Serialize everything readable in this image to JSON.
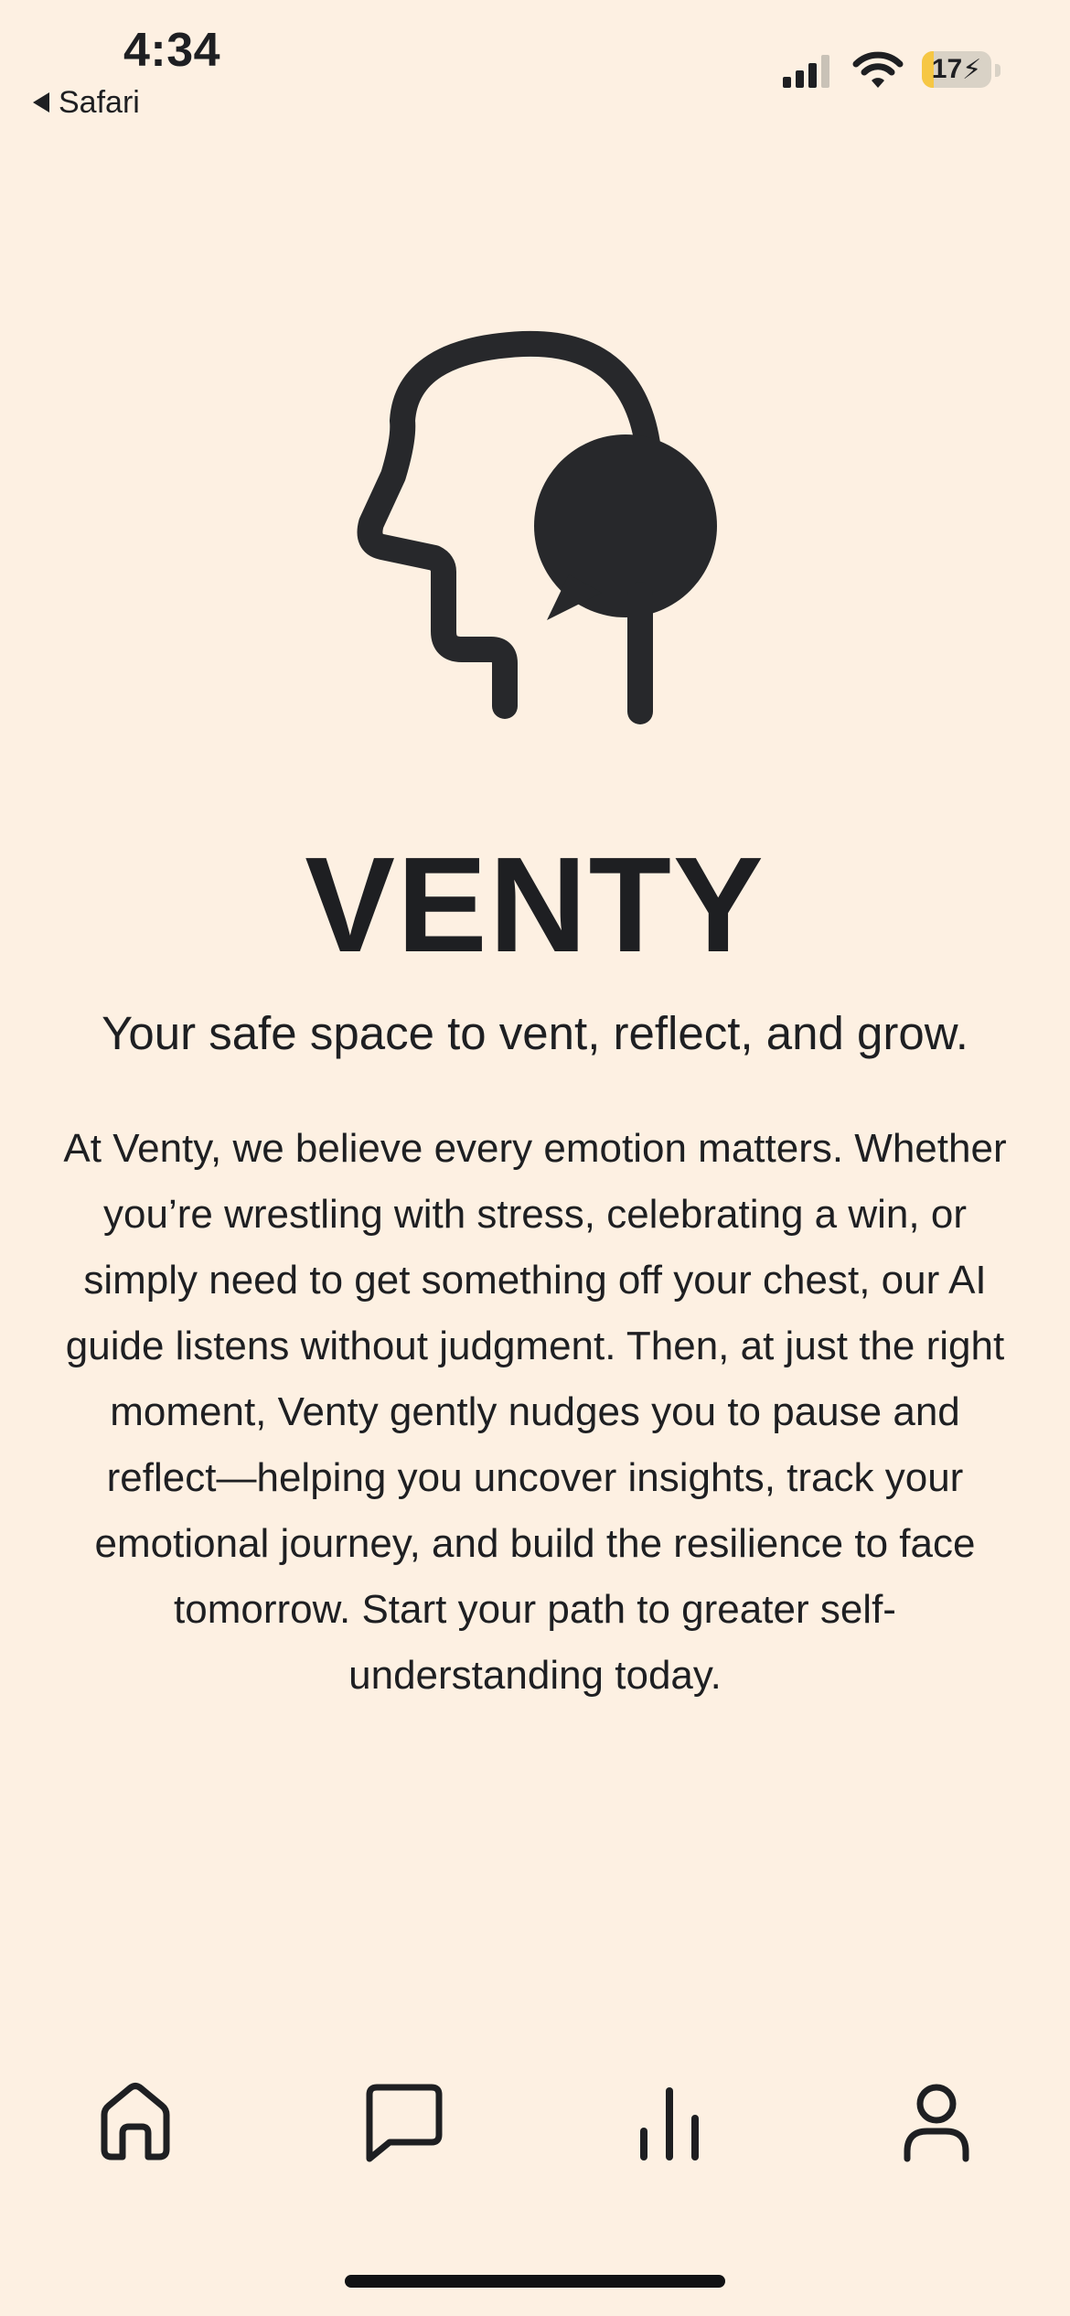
{
  "status_bar": {
    "time": "4:34",
    "back_label": "Safari",
    "battery_level": "17",
    "battery_fraction": 0.17,
    "battery_charging": true
  },
  "brand": {
    "name": "VENTY",
    "logo_icon": "head-with-speech-bubble-icon"
  },
  "tagline": "Your safe space to vent, reflect, and grow.",
  "description": "At Venty, we believe every emotion matters. Whether you’re wrestling with stress, celebrating a win, or simply need to get something off your chest, our AI guide listens without judgment. Then, at just the right moment, Venty gently nudges you to pause and reflect—helping you uncover insights, track your emotional journey, and build the resilience to face tomorrow. Start your path to greater self-understanding today.",
  "tabbar": {
    "items": [
      {
        "icon": "home-icon"
      },
      {
        "icon": "chat-icon"
      },
      {
        "icon": "stats-icon"
      },
      {
        "icon": "profile-icon"
      }
    ]
  },
  "colors": {
    "background": "#fdf0e2",
    "ink": "#1e1f22",
    "battery_accent": "#f6c744"
  }
}
